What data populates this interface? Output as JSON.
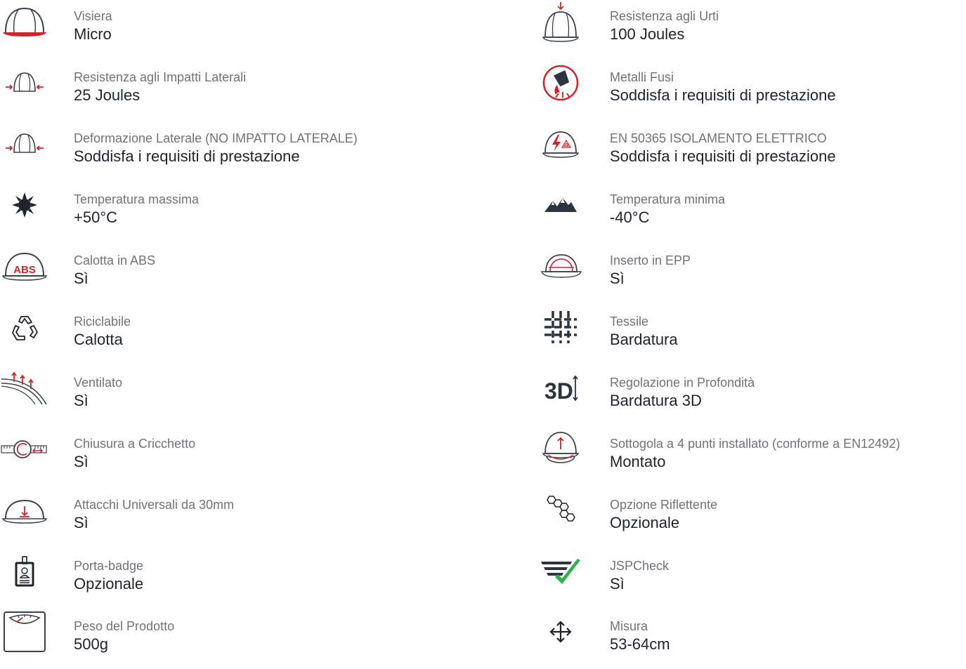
{
  "colors": {
    "outline": "#3a414a",
    "accent_red": "#d0232a",
    "check_green": "#2db34a",
    "label_gray": "#6f7378",
    "value_dark": "#1f232b"
  },
  "specs_left": [
    {
      "icon": "helmet-visor-icon",
      "label": "Visiera",
      "value": "Micro"
    },
    {
      "icon": "lateral-impact-icon",
      "label": "Resistenza agli Impatti Laterali",
      "value": "25 Joules"
    },
    {
      "icon": "lateral-deformation-icon",
      "label": "Deformazione Laterale (NO IMPATTO LATERALE)",
      "value": "Soddisfa i requisiti di prestazione"
    },
    {
      "icon": "sun-icon",
      "label": "Temperatura massima",
      "value": "+50°C"
    },
    {
      "icon": "abs-shell-icon",
      "label": "Calotta in ABS",
      "value": "Sì",
      "icon_text": "ABS"
    },
    {
      "icon": "recycle-icon",
      "label": "Riciclabile",
      "value": "Calotta"
    },
    {
      "icon": "ventilation-icon",
      "label": "Ventilato",
      "value": "Sì"
    },
    {
      "icon": "ratchet-icon",
      "label": "Chiusura a Cricchetto",
      "value": "Sì"
    },
    {
      "icon": "universal-slots-icon",
      "label": "Attacchi Universali da 30mm",
      "value": "Sì"
    },
    {
      "icon": "badge-holder-icon",
      "label": "Porta-badge",
      "value": "Opzionale"
    },
    {
      "icon": "weight-scale-icon",
      "label": "Peso del Prodotto",
      "value": "500g"
    }
  ],
  "specs_right": [
    {
      "icon": "top-impact-icon",
      "label": "Resistenza agli Urti",
      "value": "100 Joules"
    },
    {
      "icon": "molten-metal-icon",
      "label": "Metalli Fusi",
      "value": "Soddisfa i requisiti di prestazione"
    },
    {
      "icon": "electrical-insulation-icon",
      "label": "EN 50365 ISOLAMENTO ELETTRICO",
      "value": "Soddisfa i requisiti di prestazione"
    },
    {
      "icon": "mountains-icon",
      "label": "Temperatura minima",
      "value": "-40°C"
    },
    {
      "icon": "epp-insert-icon",
      "label": "Inserto in EPP",
      "value": "Sì"
    },
    {
      "icon": "textile-icon",
      "label": "Tessile",
      "value": "Bardatura"
    },
    {
      "icon": "depth-adjust-3d-icon",
      "label": "Regolazione in Profondità",
      "value": "Bardatura 3D",
      "icon_text": "3D"
    },
    {
      "icon": "chin-strap-icon",
      "label": "Sottogola a 4 punti installato (conforme a EN12492)",
      "value": "Montato"
    },
    {
      "icon": "reflective-hexagons-icon",
      "label": "Opzione Riflettente",
      "value": "Opzionale"
    },
    {
      "icon": "jspcheck-icon",
      "label": "JSPCheck",
      "value": "Sì"
    },
    {
      "icon": "size-arrows-icon",
      "label": "Misura",
      "value": "53-64cm"
    }
  ]
}
